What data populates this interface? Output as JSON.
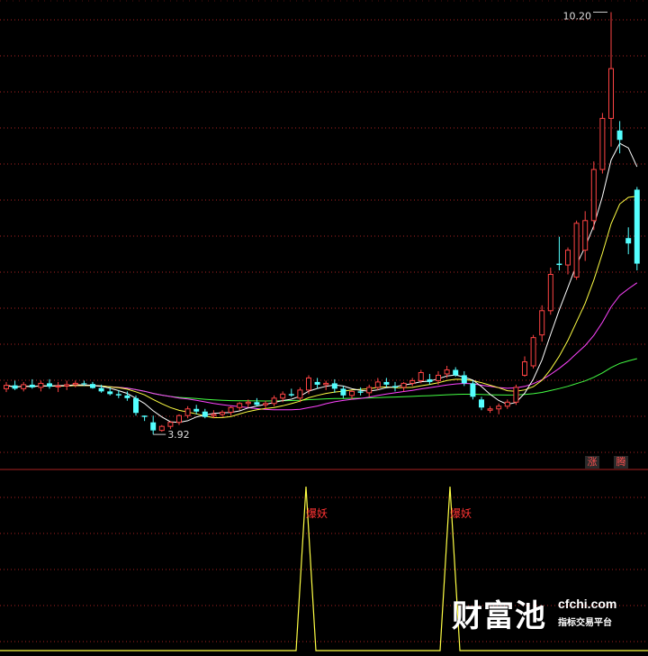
{
  "chart_data": [
    {
      "type": "candlestick",
      "title": "",
      "colors": {
        "up": "#ff4444",
        "down": "#54ffff",
        "ma5": "#ffffff",
        "ma10": "#ffff44",
        "ma20": "#ff44ff",
        "ma60": "#44ff44",
        "grid": "#aa2222"
      },
      "ylim": [
        3.6,
        10.3
      ],
      "annotations": {
        "high": "10.20",
        "low": "3.92"
      },
      "badges": [
        "涨",
        "腾"
      ],
      "ohlc": [
        [
          4.6,
          4.7,
          4.55,
          4.65
        ],
        [
          4.65,
          4.72,
          4.58,
          4.6
        ],
        [
          4.6,
          4.7,
          4.56,
          4.66
        ],
        [
          4.66,
          4.74,
          4.6,
          4.62
        ],
        [
          4.62,
          4.72,
          4.56,
          4.68
        ],
        [
          4.68,
          4.74,
          4.6,
          4.63
        ],
        [
          4.63,
          4.7,
          4.55,
          4.64
        ],
        [
          4.64,
          4.72,
          4.58,
          4.66
        ],
        [
          4.66,
          4.72,
          4.62,
          4.68
        ],
        [
          4.68,
          4.72,
          4.64,
          4.67
        ],
        [
          4.67,
          4.7,
          4.6,
          4.61
        ],
        [
          4.61,
          4.66,
          4.54,
          4.56
        ],
        [
          4.56,
          4.62,
          4.5,
          4.52
        ],
        [
          4.52,
          4.58,
          4.46,
          4.5
        ],
        [
          4.5,
          4.56,
          4.42,
          4.46
        ],
        [
          4.46,
          4.5,
          4.2,
          4.24
        ],
        [
          4.2,
          4.2,
          4.12,
          4.18
        ],
        [
          4.1,
          4.2,
          3.92,
          3.98
        ],
        [
          3.98,
          4.06,
          3.96,
          4.04
        ],
        [
          4.04,
          4.12,
          4.0,
          4.1
        ],
        [
          4.1,
          4.22,
          4.06,
          4.2
        ],
        [
          4.2,
          4.34,
          4.16,
          4.3
        ],
        [
          4.3,
          4.36,
          4.22,
          4.26
        ],
        [
          4.26,
          4.3,
          4.16,
          4.18
        ],
        [
          4.2,
          4.28,
          4.16,
          4.22
        ],
        [
          4.22,
          4.28,
          4.18,
          4.25
        ],
        [
          4.25,
          4.34,
          4.2,
          4.32
        ],
        [
          4.32,
          4.4,
          4.28,
          4.38
        ],
        [
          4.38,
          4.44,
          4.32,
          4.4
        ],
        [
          4.4,
          4.46,
          4.34,
          4.36
        ],
        [
          4.36,
          4.42,
          4.3,
          4.38
        ],
        [
          4.38,
          4.5,
          4.34,
          4.46
        ],
        [
          4.46,
          4.56,
          4.4,
          4.52
        ],
        [
          4.52,
          4.6,
          4.48,
          4.5
        ],
        [
          4.46,
          4.62,
          4.4,
          4.58
        ],
        [
          4.58,
          4.8,
          4.52,
          4.76
        ],
        [
          4.7,
          4.76,
          4.6,
          4.66
        ],
        [
          4.66,
          4.72,
          4.58,
          4.68
        ],
        [
          4.68,
          4.74,
          4.54,
          4.6
        ],
        [
          4.6,
          4.64,
          4.46,
          4.5
        ],
        [
          4.5,
          4.58,
          4.44,
          4.56
        ],
        [
          4.56,
          4.62,
          4.5,
          4.54
        ],
        [
          4.54,
          4.66,
          4.48,
          4.62
        ],
        [
          4.62,
          4.76,
          4.58,
          4.7
        ],
        [
          4.7,
          4.76,
          4.62,
          4.66
        ],
        [
          4.64,
          4.7,
          4.56,
          4.62
        ],
        [
          4.62,
          4.7,
          4.56,
          4.68
        ],
        [
          4.68,
          4.76,
          4.64,
          4.72
        ],
        [
          4.72,
          4.88,
          4.68,
          4.84
        ],
        [
          4.74,
          4.82,
          4.66,
          4.7
        ],
        [
          4.72,
          4.86,
          4.66,
          4.8
        ],
        [
          4.82,
          4.94,
          4.76,
          4.88
        ],
        [
          4.88,
          4.92,
          4.78,
          4.8
        ],
        [
          4.8,
          4.86,
          4.64,
          4.68
        ],
        [
          4.68,
          4.72,
          4.44,
          4.48
        ],
        [
          4.44,
          4.48,
          4.28,
          4.32
        ],
        [
          4.28,
          4.34,
          4.24,
          4.3
        ],
        [
          4.3,
          4.38,
          4.22,
          4.34
        ],
        [
          4.34,
          4.44,
          4.3,
          4.4
        ],
        [
          4.4,
          4.66,
          4.36,
          4.62
        ],
        [
          4.8,
          5.08,
          4.78,
          5.0
        ],
        [
          4.94,
          5.4,
          4.9,
          5.36
        ],
        [
          5.4,
          5.84,
          5.3,
          5.76
        ],
        [
          5.76,
          6.4,
          5.7,
          6.3
        ],
        [
          6.46,
          6.86,
          6.36,
          6.44
        ],
        [
          6.44,
          6.7,
          6.3,
          6.66
        ],
        [
          6.26,
          7.1,
          6.22,
          7.06
        ],
        [
          6.66,
          7.24,
          6.5,
          7.1
        ],
        [
          7.1,
          7.98,
          6.96,
          7.86
        ],
        [
          7.86,
          8.7,
          7.8,
          8.62
        ],
        [
          8.62,
          10.2,
          8.2,
          9.36
        ],
        [
          8.44,
          8.58,
          8.1,
          8.3
        ],
        [
          6.84,
          7.0,
          6.6,
          6.76
        ],
        [
          7.56,
          7.6,
          6.36,
          6.46
        ]
      ]
    },
    {
      "type": "line",
      "title": "",
      "signal_label": "爆妖",
      "ylim": [
        0,
        1
      ],
      "values": [
        0,
        0,
        0,
        0,
        0,
        0,
        0,
        0,
        0,
        0,
        0,
        0,
        0,
        0,
        0,
        0,
        0,
        0,
        0,
        0,
        0,
        0,
        0,
        0,
        0,
        0,
        0,
        0,
        0,
        0,
        0,
        0,
        0,
        0,
        0,
        0,
        0,
        0,
        0,
        0,
        0,
        0,
        0,
        0,
        0,
        0,
        0,
        0,
        0,
        0,
        0,
        0,
        0,
        0,
        0,
        0,
        0,
        0,
        0,
        0,
        0,
        0,
        0,
        0,
        0,
        0,
        0,
        0,
        0,
        0,
        0,
        0,
        0,
        0
      ],
      "spikes": [
        25,
        45
      ]
    }
  ],
  "watermark": {
    "brand": "财富池",
    "site": "cfchi.com",
    "tagline": "指标交易平台"
  }
}
